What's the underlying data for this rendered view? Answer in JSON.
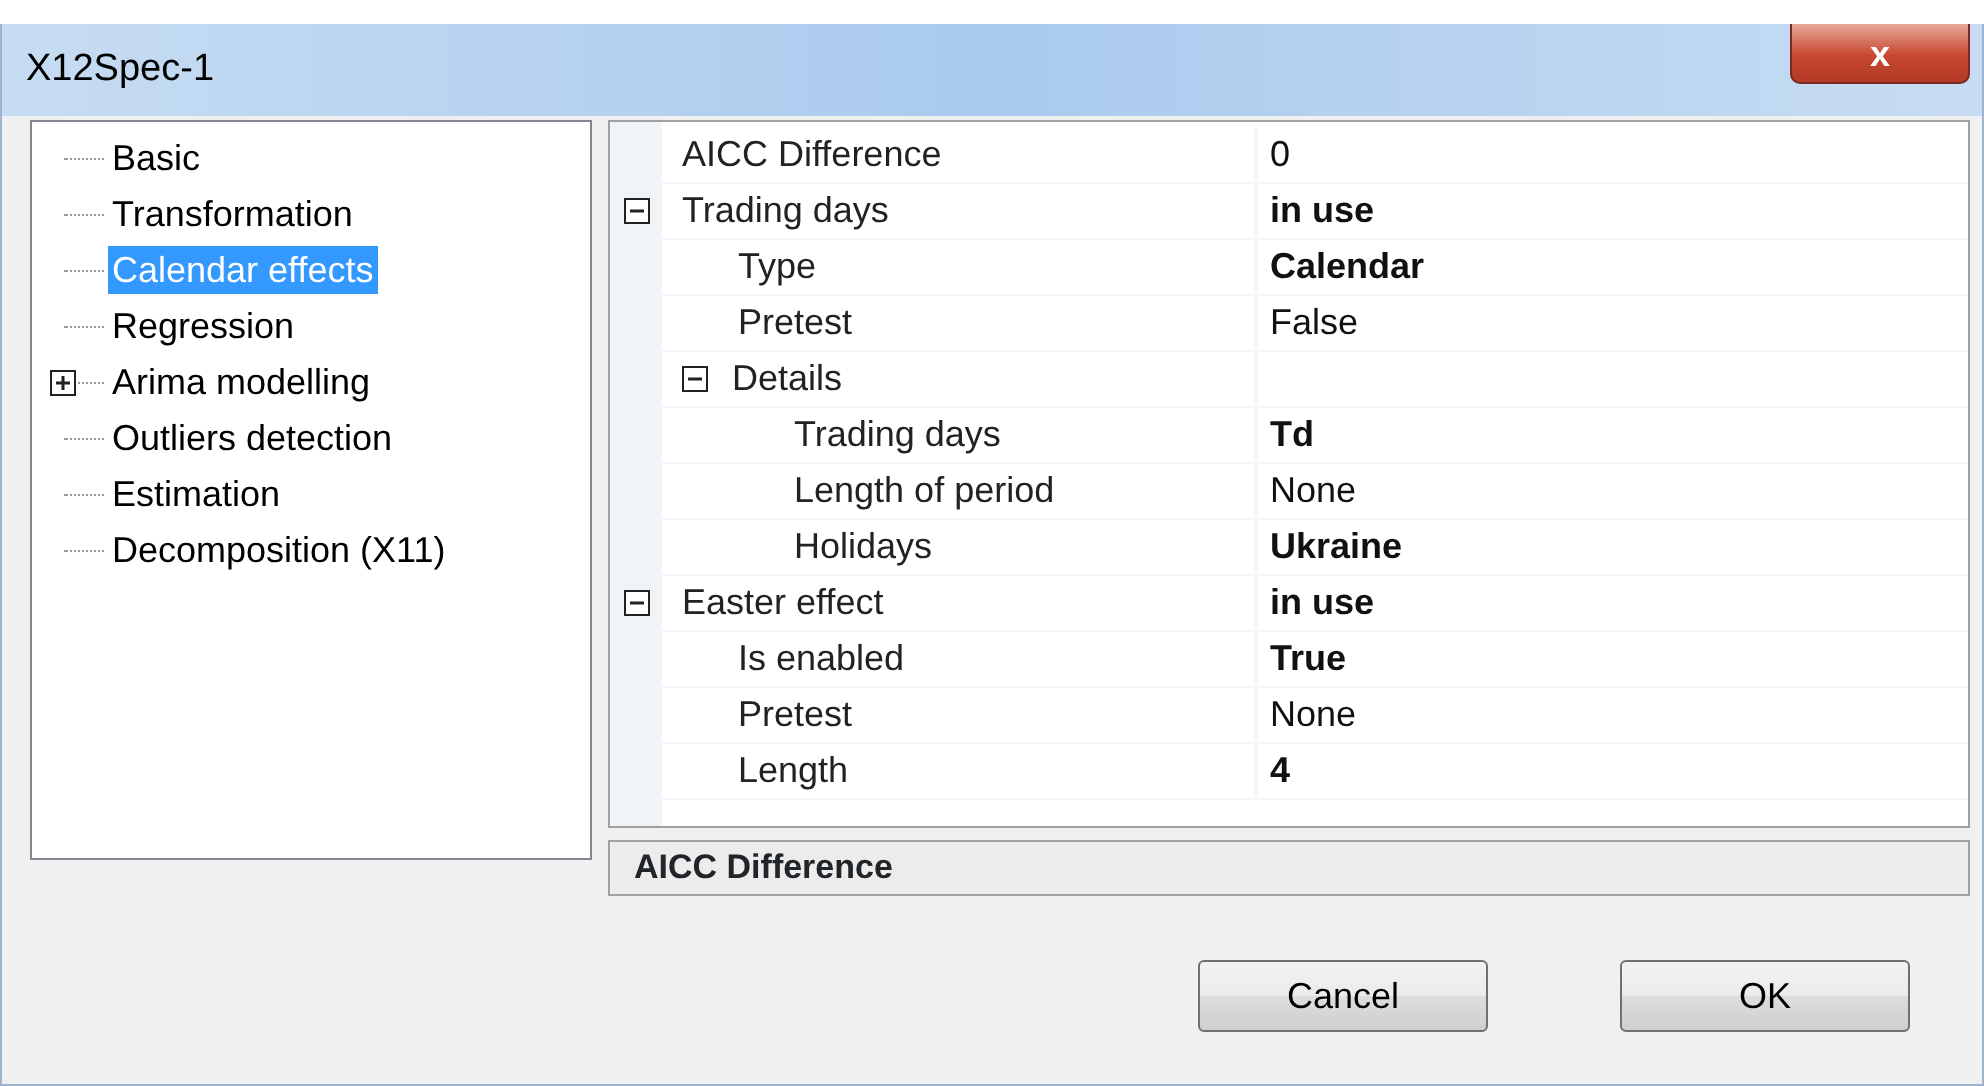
{
  "window": {
    "title": "X12Spec-1",
    "close_label": "x"
  },
  "tree": [
    {
      "label": "Basic",
      "kind": "leaf",
      "selected": false
    },
    {
      "label": "Transformation",
      "kind": "leaf",
      "selected": false
    },
    {
      "label": "Calendar effects",
      "kind": "leaf",
      "selected": true
    },
    {
      "label": "Regression",
      "kind": "leaf",
      "selected": false
    },
    {
      "label": "Arima modelling",
      "kind": "collapsed",
      "selected": false
    },
    {
      "label": "Outliers detection",
      "kind": "leaf",
      "selected": false
    },
    {
      "label": "Estimation",
      "kind": "leaf",
      "selected": false
    },
    {
      "label": "Decomposition (X11)",
      "kind": "leaf",
      "selected": false
    }
  ],
  "properties": [
    {
      "name": "AICC Difference",
      "value": "0",
      "modified": false
    },
    {
      "name": "Trading days",
      "value": "in use",
      "modified": true,
      "expanded": true,
      "children": [
        {
          "name": "Type",
          "value": "Calendar",
          "modified": true
        },
        {
          "name": "Pretest",
          "value": "False",
          "modified": false
        },
        {
          "name": "Details",
          "expanded": true,
          "children": [
            {
              "name": "Trading days",
              "value": "Td",
              "modified": true
            },
            {
              "name": "Length of period",
              "value": "None",
              "modified": false
            },
            {
              "name": "Holidays",
              "value": "Ukraine",
              "modified": true
            }
          ]
        }
      ]
    },
    {
      "name": "Easter effect",
      "value": "in use",
      "modified": true,
      "expanded": true,
      "children": [
        {
          "name": "Is enabled",
          "value": "True",
          "modified": true
        },
        {
          "name": "Pretest",
          "value": "None",
          "modified": false
        },
        {
          "name": "Length",
          "value": "4",
          "modified": true
        }
      ]
    }
  ],
  "description": {
    "title": "AICC Difference"
  },
  "buttons": [
    "Cancel",
    "OK"
  ]
}
